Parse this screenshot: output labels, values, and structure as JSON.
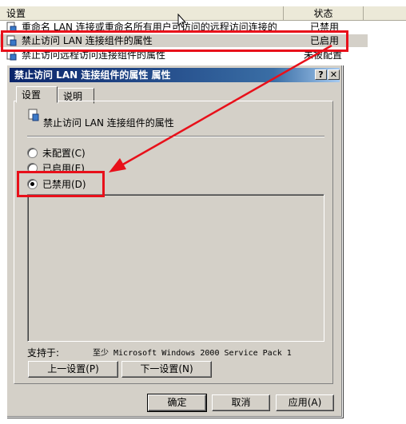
{
  "list": {
    "col_setting": "设置",
    "col_status": "状态",
    "rows": [
      {
        "name": "重命名 LAN 连接或重命名所有用户可访问的远程访问连接的",
        "status": "已禁用"
      },
      {
        "name": "禁止访问 LAN 连接组件的属性",
        "status": "已启用"
      },
      {
        "name": "禁止访问远程访问连接组件的属性",
        "status": "未被配置"
      }
    ]
  },
  "dialog": {
    "title": "禁止访问 LAN 连接组件的属性 属性",
    "help_btn": "?",
    "close_btn": "✕",
    "tabs": [
      "设置",
      "说明"
    ],
    "setting_name": "禁止访问 LAN 连接组件的属性",
    "radios": [
      {
        "label": "未配置(C)",
        "selected": false
      },
      {
        "label": "已启用(E)",
        "selected": false
      },
      {
        "label": "已禁用(D)",
        "selected": true
      }
    ],
    "supported_label": "支持于:",
    "supported_value": "至少 Microsoft Windows 2000 Service Pack 1",
    "prev_btn": "上一设置(P)",
    "next_btn": "下一设置(N)",
    "ok_btn": "确定",
    "cancel_btn": "取消",
    "apply_btn": "应用(A)"
  },
  "colors": {
    "annotation": "#e8101a",
    "title_bar": "#0a246a"
  }
}
